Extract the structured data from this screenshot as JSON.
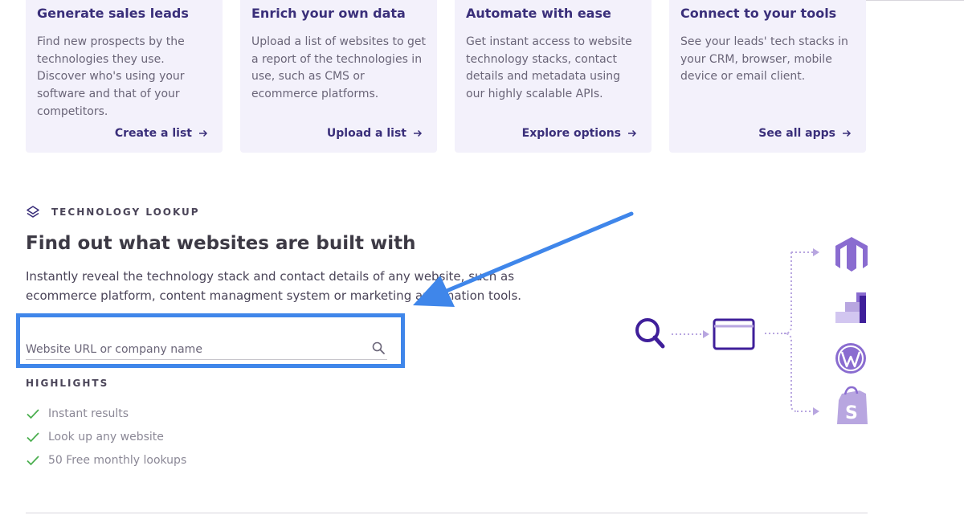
{
  "cards": [
    {
      "title": "Generate sales leads",
      "description": "Find new prospects by the technologies they use. Discover who's using your software and that of your competitors.",
      "link": "Create a list"
    },
    {
      "title": "Enrich your own data",
      "description": "Upload a list of websites to get a report of the technologies in use, such as CMS or ecommerce platforms.",
      "link": "Upload a list"
    },
    {
      "title": "Automate with ease",
      "description": "Get instant access to website technology stacks, contact details and metadata using our highly scalable APIs.",
      "link": "Explore options"
    },
    {
      "title": "Connect to your tools",
      "description": "See your leads' tech stacks in your CRM, browser, mobile device or email client.",
      "link": "See all apps"
    }
  ],
  "lookup": {
    "eyebrow": "TECHNOLOGY LOOKUP",
    "headline": "Find out what websites are built with",
    "subtext": "Instantly reveal the technology stack and contact details of any website, such as ecommerce platform, content managment system or marketing automation tools.",
    "search_placeholder": "Website URL or company name",
    "search_value": ""
  },
  "highlights": {
    "title": "HIGHLIGHTS",
    "items": [
      "Instant results",
      "Look up any website",
      "50 Free monthly lookups"
    ]
  },
  "icons": {
    "eyebrow": "layers-icon",
    "link_arrow": "arrow-right-icon",
    "search": "search-icon",
    "check": "check-icon",
    "diagram": [
      "magnifier-icon",
      "browser-window-icon",
      "magento-logo-icon",
      "bar-chart-logo-icon",
      "wordpress-logo-icon",
      "shopify-logo-icon"
    ]
  },
  "colors": {
    "brand_dark": "#3a2f7a",
    "brand": "#5b3fa8",
    "brand_light": "#b8a6e0",
    "card_bg": "#f3f1fb",
    "annotation_blue": "#3f86ea",
    "check_green": "#4caf50"
  }
}
